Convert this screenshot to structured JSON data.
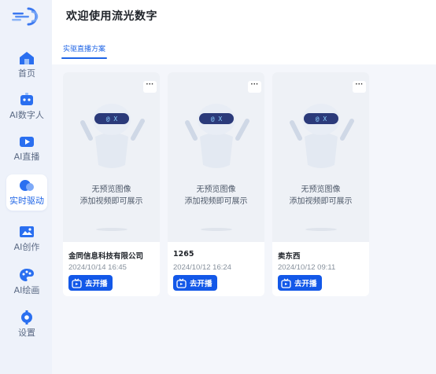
{
  "app": {
    "welcome": "欢迎使用流光数字"
  },
  "sidebar": {
    "items": [
      {
        "label": "首页",
        "icon": "home-icon"
      },
      {
        "label": "AI数字人",
        "icon": "digital-human-icon"
      },
      {
        "label": "AI直播",
        "icon": "live-icon"
      },
      {
        "label": "实时驱动",
        "icon": "realtime-drive-icon",
        "active": true
      },
      {
        "label": "AI创作",
        "icon": "creation-icon"
      },
      {
        "label": "AI绘画",
        "icon": "painting-icon"
      },
      {
        "label": "设置",
        "icon": "settings-icon"
      }
    ]
  },
  "main": {
    "tab": "实驱直播方案",
    "cards": [
      {
        "name": "金同信息科技有限公司",
        "time": "2024/10/14 16:45",
        "no_preview": "无预览图像",
        "hint": "添加视频即可展示",
        "button": "去开播",
        "more": "···"
      },
      {
        "name": "1265",
        "time": "2024/10/12 16:24",
        "no_preview": "无预览图像",
        "hint": "添加视频即可展示",
        "button": "去开播",
        "more": "···"
      },
      {
        "name": "卖东西",
        "time": "2024/10/12 09:11",
        "no_preview": "无预览图像",
        "hint": "添加视频即可展示",
        "button": "去开播",
        "more": "···"
      }
    ]
  },
  "colors": {
    "accent": "#1e64e6",
    "button": "#1358e8",
    "sidebar_bg": "#eef2fa",
    "content_bg": "#f4f6fb"
  }
}
